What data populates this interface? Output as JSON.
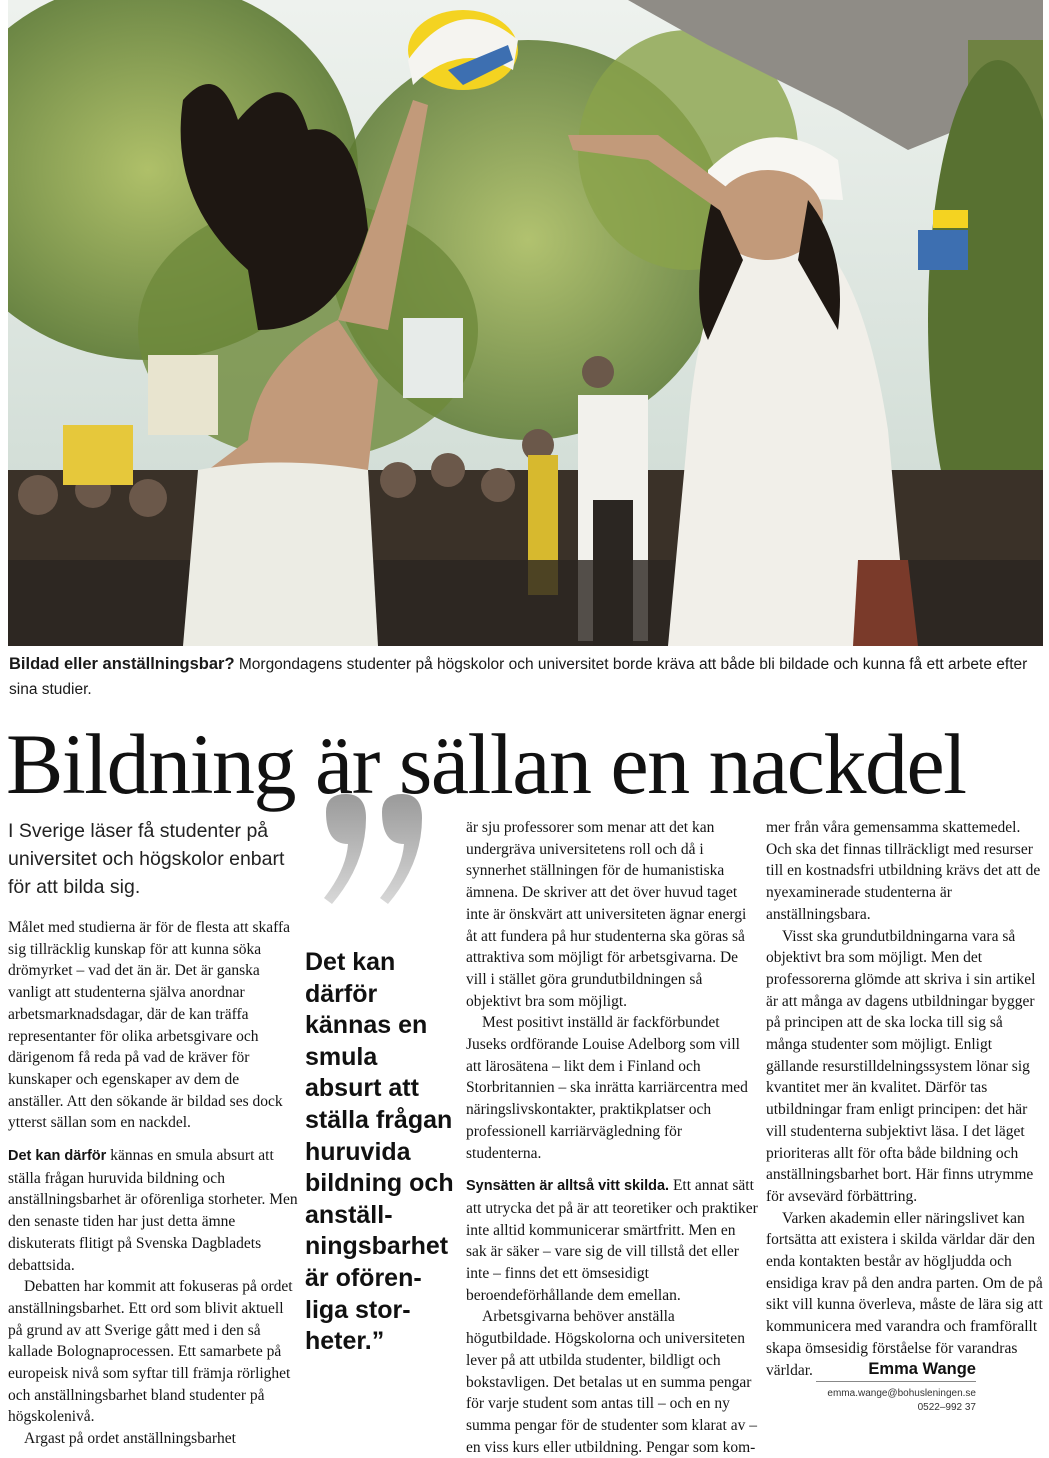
{
  "photo": {
    "alt_subject": "graduates-celebrating",
    "colors": {
      "sky": "#d9e4e2",
      "foliage": "#7f9a45",
      "dress": "#f1efe9",
      "cap_yellow": "#f4d321",
      "cap_blue": "#3d6fb1",
      "hair": "#1e1712"
    }
  },
  "caption": {
    "bold": "Bildad eller anställningsbar?",
    "text": " Morgondagens studenter på högskolor och universitet borde kräva att både bli bildade och kunna få ett arbete efter sina studier."
  },
  "headline": "Bildning är sällan en nackdel",
  "ingress": "I Sverige läser få studenter på universitet och högskolor enbart för att bilda sig.",
  "pullquote": "Det kan därför kännas en smula absurt att ställa frågan huruvida bildning och anställ­ningsbarhet är ofören­liga stor­heter.”",
  "col1": {
    "p1": "Målet med studierna är för de flesta att skaffa sig tillräcklig kunskap för att kunna söka drömyrket – vad det än är. Det är ganska vanligt att studenterna själva anordnar arbetsmarknadsdagar, där de kan träffa representanter för olika arbetsgivare och därigenom få reda på vad de kräver för kunskaper och egenskaper av dem de anställer. Att den sökande är bildad ses dock ytterst sällan som en nackdel.",
    "p2_lead": "Det kan därför",
    "p2": " kännas en smula absurt att ställa frågan huruvida bildning och anställningsbarhet är oförenliga storheter. Men den senaste tiden har just detta ämne diskuterats flitigt på Svenska Dagbladets debattsida.",
    "p3": "Debatten har kommit att fokuseras på ordet anställningsbarhet. Ett ord som blivit aktuell på grund av att Sverige gått med i den så kallade Bolognaprocessen. Ett samarbete på europeisk nivå som syftar till främja rörlighet och anställningsbarhet bland studenter på högskolenivå.",
    "p4": "Argast på ordet anställningsbarhet"
  },
  "col2": {
    "p1": "är sju professorer som menar att det kan undergräva universitetens roll och då i synnerhet ställningen för de humanistiska ämnena. De skriver att det över huvud taget inte är önskvärt att universiteten ägnar energi åt att fundera på hur studenterna ska göras så attraktiva som möjligt för arbetsgivarna. De vill i stället göra grundutbildningen så objektivt bra som möjligt.",
    "p2": "Mest positivt inställd är fackförbundet Juseks ordförande Louise Adelborg som vill att lärosätena – likt dem i Finland och Storbritannien – ska inrätta karriärcentra med näringslivskontakter, praktikplatser och professionell karriärvägledning för studenterna.",
    "p3_lead": "Synsätten är alltså vitt skilda.",
    "p3": " Ett annat sätt att utrycka det på är att teoretiker och praktiker inte alltid kommunicerar smärtfritt. Men en sak är säker – vare sig de vill tillstå det eller inte – finns det ett ömsesidigt beroendeförhållande dem emellan.",
    "p4": "Arbetsgivarna behöver anställa högutbildade. Högskolorna och universiteten lever på att utbilda studenter, bildligt och bokstavligen. Det betalas ut en summa pengar för varje student som antas till – och en ny summa pengar för de studenter som klarat av – en viss kurs eller utbildning. Pengar som kom-"
  },
  "col3": {
    "p1": "mer från våra gemensamma skattemedel. Och ska det finnas tillräckligt med resurser till en kostnadsfri utbildning krävs det att de nyexaminerade studenterna är anställningsbara.",
    "p2": "Visst ska grundutbildningarna vara så objektivt bra som möjligt. Men det professorerna glömde att skriva i sin artikel är att många av dagens utbildningar bygger på principen att de ska locka till sig så många studenter som möjligt. Enligt gällande resurstilldelningssystem lönar sig kvantitet mer än kvalitet. Därför tas utbildningar fram enligt principen: det här vill studenterna subjektivt läsa. I det läget prioriteras allt för ofta både bildning och anställningsbarhet bort. Här finns utrymme för avsevärd förbättring.",
    "p3": "Varken akademin eller näringslivet kan fortsätta att existera i skilda världar där den enda kontakten består av högljudda och ensidiga krav på den andra parten. Om de på sikt vill kunna överleva, måste de lära sig att kommunicera med varandra och framförallt skapa ömsesidig förståelse för varandras världar."
  },
  "byline": {
    "name": "Emma Wange",
    "email": "emma.wange@bohusleningen.se",
    "phone": "0522–992 37"
  }
}
